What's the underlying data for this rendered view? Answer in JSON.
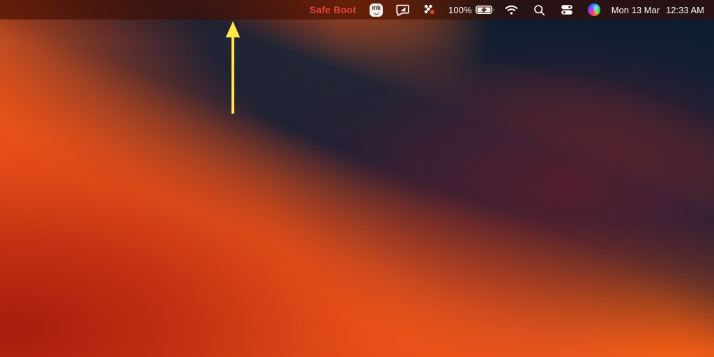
{
  "menubar": {
    "status_text": "Safe Boot",
    "status_color": "#e8453c",
    "background_color": "#3c0e04",
    "items": [
      {
        "name": "mk-app-icon",
        "label": "mk"
      },
      {
        "name": "snip-tool-icon",
        "label": ""
      },
      {
        "name": "cluster-sync-icon",
        "label": ""
      }
    ],
    "battery": {
      "percent": "100%",
      "charging": true
    },
    "wifi": {
      "connected": true
    },
    "search": {
      "label": ""
    },
    "control_center": {
      "label": ""
    },
    "siri": {
      "label": ""
    },
    "clock": {
      "date": "Mon 13 Mar",
      "time": "12:33 AM"
    }
  },
  "annotation": {
    "arrow_color": "#ffe94a",
    "arrow_direction": "up",
    "points_to": "Safe Boot"
  },
  "desktop": {
    "wallpaper_name": "macOS Ventura",
    "colors": {
      "navy": "#0d2034",
      "red": "#c8200e",
      "orange": "#f87d02",
      "bright_orange": "#ffa200",
      "maroon": "#7e1a2a"
    }
  }
}
